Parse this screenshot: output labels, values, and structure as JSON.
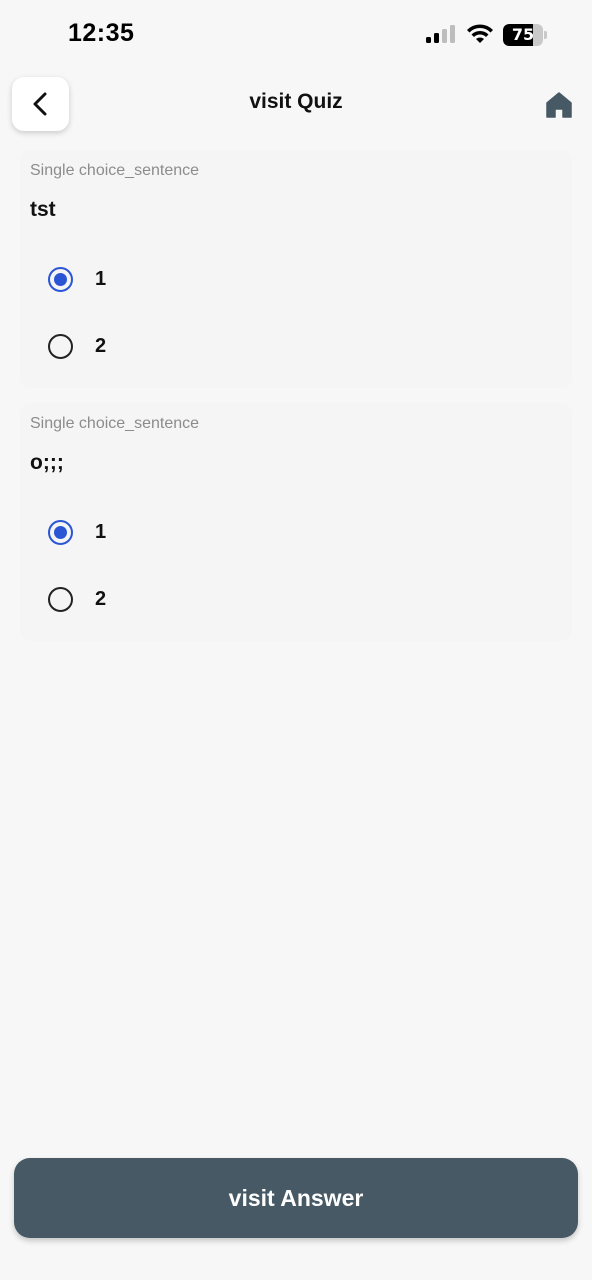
{
  "status_bar": {
    "time": "12:35",
    "battery_percent": "75",
    "battery_level": 0.75,
    "signal_icon": "cellular-signal-icon",
    "wifi_icon": "wifi-icon"
  },
  "header": {
    "title": "visit Quiz",
    "back_icon": "chevron-left-icon",
    "home_icon": "home-icon"
  },
  "questions": [
    {
      "type_label": "Single choice_sentence",
      "text": "tst",
      "options": [
        {
          "label": "1",
          "selected": true
        },
        {
          "label": "2",
          "selected": false
        }
      ]
    },
    {
      "type_label": "Single choice_sentence",
      "text": "o;;;",
      "options": [
        {
          "label": "1",
          "selected": true
        },
        {
          "label": "2",
          "selected": false
        }
      ]
    }
  ],
  "footer": {
    "submit_label": "visit Answer"
  },
  "colors": {
    "accent": "#2a56d6",
    "button_bg": "#475965",
    "home_icon": "#475965"
  }
}
